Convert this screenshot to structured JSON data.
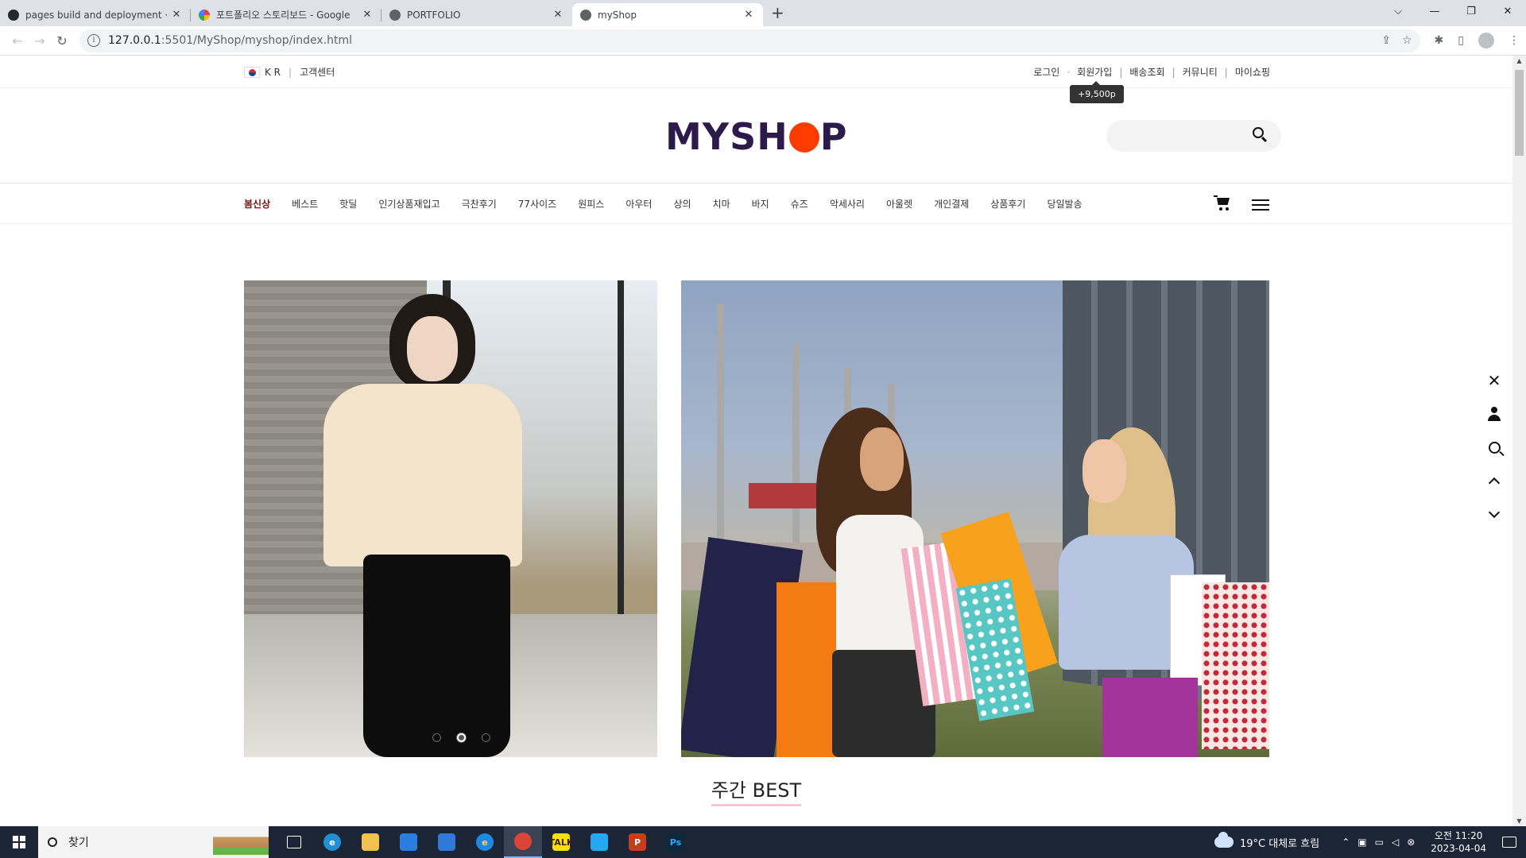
{
  "browser": {
    "tabs": [
      {
        "title": "pages build and deployment · v",
        "favicon_color": "#24292f"
      },
      {
        "title": "포트폴리오 스토리보드 - Google",
        "favicon_color": "#4285f4"
      },
      {
        "title": "PORTFOLIO",
        "favicon_color": "#5f6368"
      },
      {
        "title": "myShop",
        "favicon_color": "#5f6368",
        "active": true
      }
    ],
    "url_host": "127.0.0.1",
    "url_path": ":5501/MyShop/myshop/index.html"
  },
  "util": {
    "lang": "K R",
    "customer_center": "고객센터",
    "links": [
      "로그인",
      "회원가입",
      "배송조회",
      "커뮤니티",
      "마이쇼핑"
    ],
    "tooltip": "+9,500p"
  },
  "header": {
    "logo_before": "MYSH",
    "logo_after": "P",
    "logo_dot_color": "#ff3b00",
    "search_placeholder": ""
  },
  "gnb": {
    "items": [
      "봄신상",
      "베스트",
      "핫딜",
      "인기상품재입고",
      "극찬후기",
      "77사이즈",
      "원피스",
      "아우터",
      "상의",
      "치마",
      "바지",
      "슈즈",
      "악세사리",
      "아울렛",
      "개인결제",
      "상품후기",
      "당일발송"
    ],
    "active_index": 0
  },
  "slider": {
    "dot_count": 3,
    "active_dot": 1
  },
  "section": {
    "best_title": "주간 BEST"
  },
  "quick_menu": [
    "close-icon",
    "user-icon",
    "search-icon",
    "chevron-up-icon",
    "chevron-down-icon"
  ],
  "taskbar": {
    "search_label": "찾기",
    "weather": "19°C  대체로 흐림",
    "time": "오전 11:20",
    "date": "2023-04-04",
    "apps": [
      {
        "name": "task-view",
        "label": "",
        "color": "#1c2535",
        "fg": "#fff"
      },
      {
        "name": "edge",
        "label": "e",
        "color": "#1f8fd6",
        "fg": "#fff"
      },
      {
        "name": "file-explorer",
        "label": "",
        "color": "#f2c14e",
        "fg": "#000"
      },
      {
        "name": "store",
        "label": "",
        "color": "#2a7de1",
        "fg": "#fff"
      },
      {
        "name": "mail",
        "label": "",
        "color": "#2f7ad8",
        "fg": "#fff"
      },
      {
        "name": "ie",
        "label": "e",
        "color": "#1e88e5",
        "fg": "#ffd54f"
      },
      {
        "name": "chrome",
        "label": "",
        "color": "#db4437",
        "fg": "#fff"
      },
      {
        "name": "kakaotalk",
        "label": "TALK",
        "color": "#f9e000",
        "fg": "#3c1e1e"
      },
      {
        "name": "vscode",
        "label": "",
        "color": "#23a9f2",
        "fg": "#fff"
      },
      {
        "name": "powerpoint",
        "label": "P",
        "color": "#c43e1c",
        "fg": "#fff"
      },
      {
        "name": "photoshop",
        "label": "Ps",
        "color": "#0b2a3b",
        "fg": "#31a8ff"
      }
    ]
  }
}
